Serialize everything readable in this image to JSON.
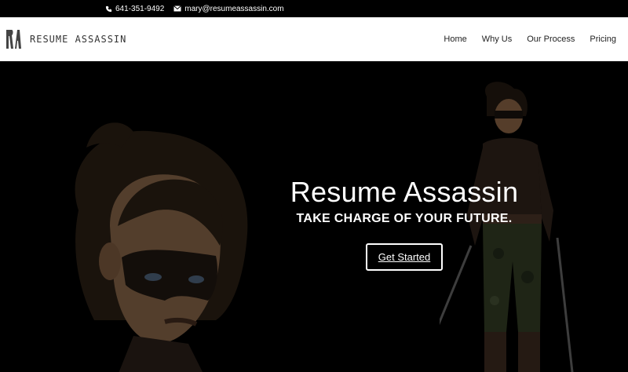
{
  "topbar": {
    "phone": "641-351-9492",
    "email": "mary@resumeassassin.com"
  },
  "header": {
    "logo_text": "RESUME ASSASSIN",
    "nav": [
      "Home",
      "Why Us",
      "Our Process",
      "Pricing"
    ]
  },
  "hero": {
    "title": "Resume Assassin",
    "subtitle": "TAKE CHARGE OF YOUR FUTURE.",
    "cta_label": "Get Started"
  },
  "colors": {
    "topbar_bg": "#000000",
    "header_bg": "#ffffff",
    "hero_bg": "#000000",
    "cta_border": "#ffffff"
  }
}
